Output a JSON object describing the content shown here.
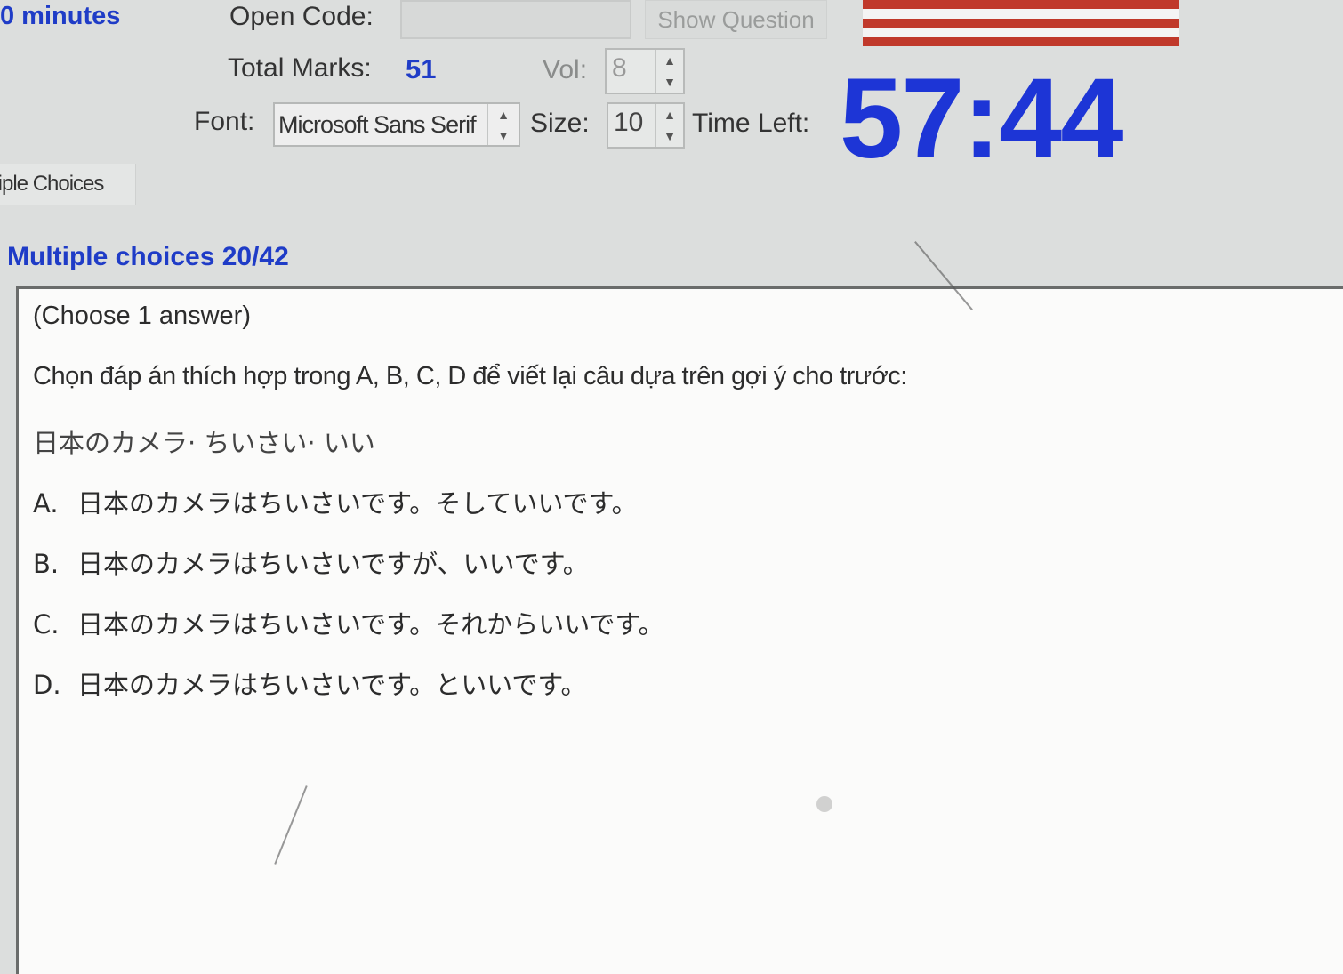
{
  "header": {
    "duration_text": "0 minutes",
    "open_code_label": "Open Code:",
    "open_code_value": "",
    "show_question_label": "Show Question",
    "total_marks_label": "Total Marks:",
    "total_marks_value": "51",
    "vol_label": "Vol:",
    "vol_value": "8",
    "font_label": "Font:",
    "font_value": "Microsoft Sans Serif",
    "size_label": "Size:",
    "size_value": "10",
    "time_left_label": "Time Left:",
    "time_left_value": "57:44"
  },
  "flag_colors": [
    "#c0392b",
    "#ffffff",
    "#c0392b",
    "#ffffff",
    "#c0392b"
  ],
  "tab": {
    "label": "tiple Choices"
  },
  "section": {
    "title": "Multiple choices 20/42"
  },
  "question": {
    "instruction": "(Choose 1 answer)",
    "prompt": "Chọn đáp án thích hợp trong A, B, C, D để viết lại câu dựa trên gợi ý cho trước:",
    "cue": "日本のカメラ· ちいさい· いい",
    "options": [
      {
        "letter": "A.",
        "text": "日本のカメラはちいさいです。そしていいです。"
      },
      {
        "letter": "B.",
        "text": "日本のカメラはちいさいですが、いいです。"
      },
      {
        "letter": "C.",
        "text": "日本のカメラはちいさいです。それからいいです。"
      },
      {
        "letter": "D.",
        "text": "日本のカメラはちいさいです。といいです。"
      }
    ]
  },
  "colors": {
    "accent_blue": "#1f3cc7",
    "timer_blue": "#1d35d6",
    "panel_bg": "#fbfbfa",
    "window_bg": "#dcdedd"
  }
}
